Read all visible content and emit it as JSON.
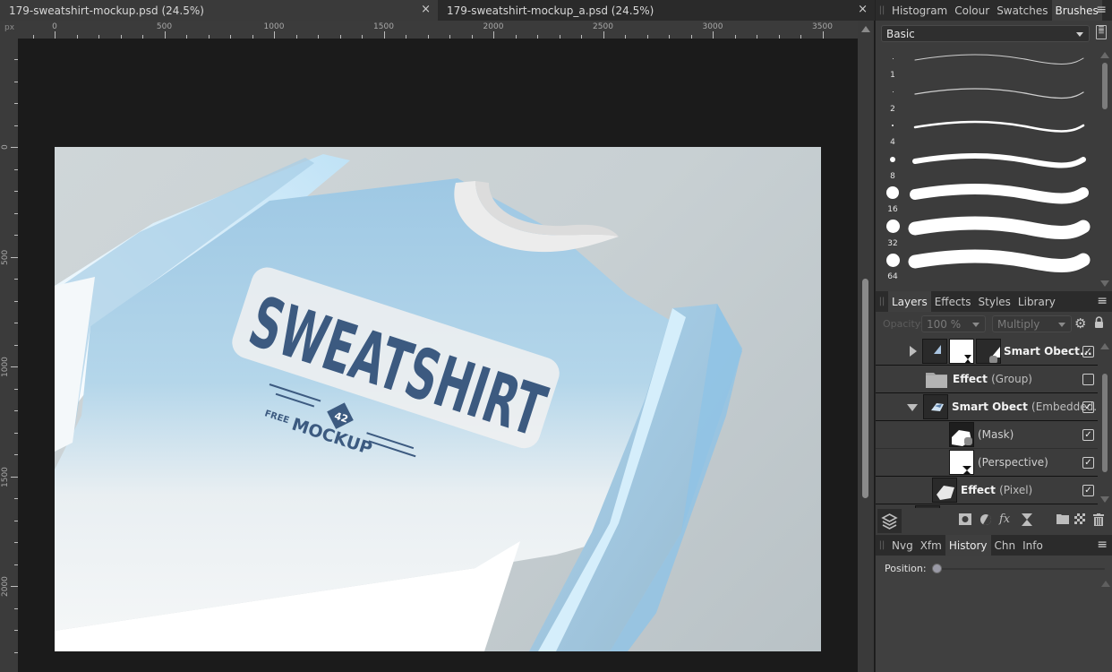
{
  "documents": {
    "tabs": [
      {
        "title": "179-sweatshirt-mockup.psd (24.5%)",
        "active": true
      },
      {
        "title": "179-sweatshirt-mockup_a.psd (24.5%)",
        "active": false
      }
    ],
    "close_glyph": "×"
  },
  "rulers": {
    "unit": "px",
    "horizontal_labels": [
      "0",
      "500",
      "1000",
      "1500",
      "2000",
      "2500",
      "3000",
      "3500"
    ],
    "vertical_labels": [
      "0",
      "500",
      "1000",
      "1500",
      "2000"
    ]
  },
  "canvas": {
    "zoom": "24.5%",
    "artwork": {
      "headline": "SWEATSHIRT",
      "badge_number": "42",
      "tag_free": "FREE",
      "tag_mockup": "MOCKUP",
      "colors": {
        "background": "#c9d1d4",
        "shirt_blue": "#9cc9e6",
        "shirt_light": "#eef3f6",
        "print_navy": "#3c5a80",
        "collar": "#ededed"
      }
    }
  },
  "top_panel": {
    "tabs": [
      "Histogram",
      "Colour",
      "Swatches",
      "Brushes"
    ],
    "active_tab": "Brushes",
    "brush_category": "Basic",
    "brushes": [
      {
        "size": "1"
      },
      {
        "size": "2"
      },
      {
        "size": "4"
      },
      {
        "size": "8"
      },
      {
        "size": "16"
      },
      {
        "size": "32"
      },
      {
        "size": "64"
      }
    ]
  },
  "layers_panel": {
    "tabs": [
      "Layers",
      "Effects",
      "Styles",
      "Library"
    ],
    "active_tab": "Layers",
    "opacity_label": "Opacity:",
    "opacity_value": "100 %",
    "blend_mode": "Multiply",
    "layers": [
      {
        "name": "Smart Obect...",
        "detail": "",
        "expanded": false,
        "visible": true
      },
      {
        "name": "Effect",
        "detail": "(Group)",
        "visible": false
      },
      {
        "name": "Smart Obect",
        "detail": "(Embedded...",
        "expanded": true,
        "visible": true
      },
      {
        "name": "",
        "detail": "(Mask)",
        "visible": true
      },
      {
        "name": "",
        "detail": "(Perspective)",
        "visible": true
      },
      {
        "name": "Effect",
        "detail": "(Pixel)",
        "visible": true
      }
    ],
    "check_glyph": "✓"
  },
  "bottom_panel": {
    "tabs": [
      "Nvg",
      "Xfm",
      "History",
      "Chn",
      "Info"
    ],
    "active_tab": "History",
    "position_label": "Position:",
    "position_value": 0
  }
}
